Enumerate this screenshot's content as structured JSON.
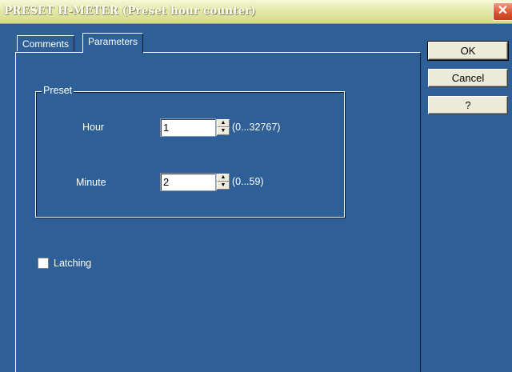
{
  "window": {
    "title": "PRESET H-METER (Preset hour counter)",
    "close_glyph": "✕"
  },
  "tabs": [
    {
      "label": "Comments",
      "selected": false
    },
    {
      "label": "Parameters",
      "selected": true
    }
  ],
  "buttons": {
    "ok": "OK",
    "cancel": "Cancel",
    "help": "?"
  },
  "preset": {
    "group_label": "Preset",
    "hour": {
      "label": "Hour",
      "value": "1",
      "range": "(0...32767)"
    },
    "minute": {
      "label": "Minute",
      "value": "2",
      "range": "(0...59)"
    }
  },
  "latching": {
    "label": "Latching",
    "checked": false
  },
  "icons": {
    "spin_up": "▲",
    "spin_down": "▼"
  },
  "colors": {
    "background": "#2e6097",
    "titlebar": "#e3e8a8",
    "close_button": "#d9512e",
    "button_face": "#ecead8"
  }
}
